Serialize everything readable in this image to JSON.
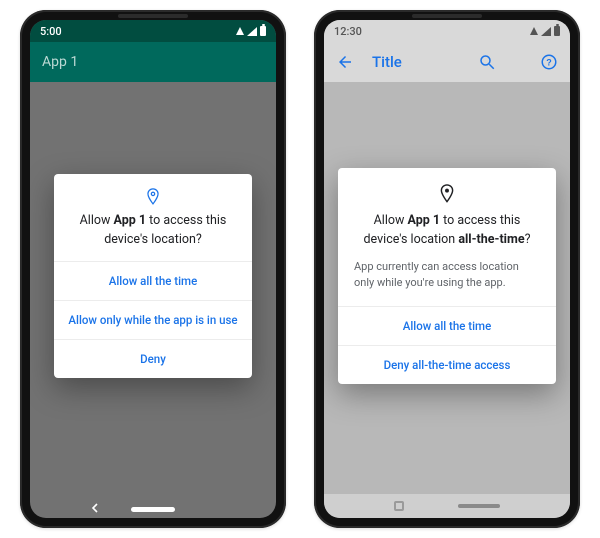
{
  "phone1": {
    "status_time": "5:00",
    "app_title": "App 1",
    "dialog": {
      "title_pre": "Allow ",
      "title_app": "App 1",
      "title_post": " to access this device's location?",
      "opt_allow_always": "Allow all the time",
      "opt_allow_in_use": "Allow only while the app is in use",
      "opt_deny": "Deny"
    }
  },
  "phone2": {
    "status_time": "12:30",
    "app_title": "Title",
    "dialog": {
      "title_pre": "Allow ",
      "title_app": "App 1",
      "title_mid": " to access this device's location ",
      "title_suffix": "all-the-time",
      "title_q": "?",
      "subtitle": "App currently can access location only while you're using the app.",
      "opt_allow_always": "Allow all the time",
      "opt_deny_all": "Deny all-the-time access"
    }
  }
}
